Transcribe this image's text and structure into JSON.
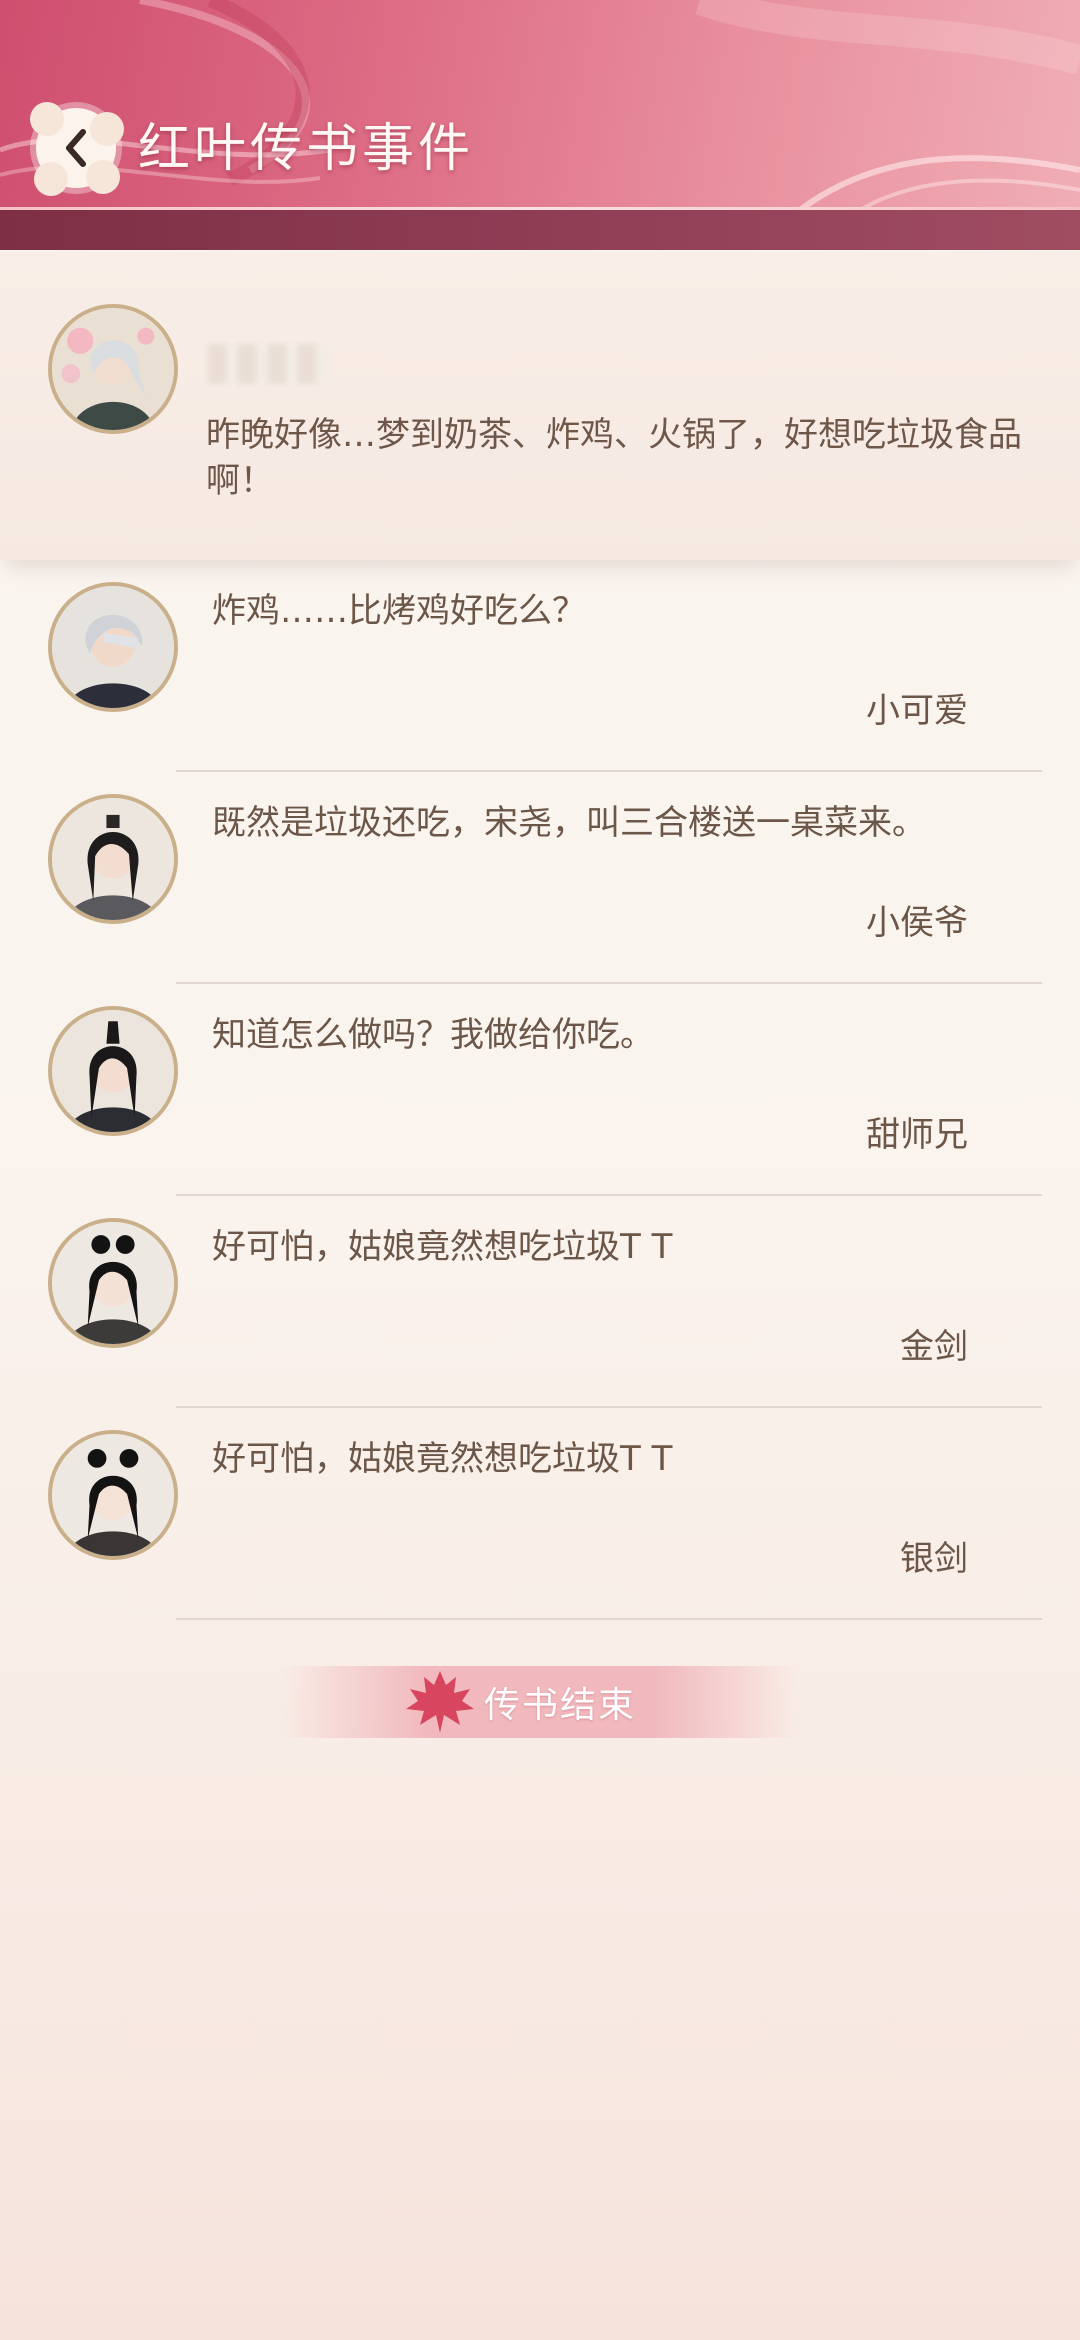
{
  "header": {
    "title": "红叶传书事件",
    "back_icon": "chevron-left-icon",
    "colors": {
      "primary": "#d4577a",
      "band": "#8a3a50"
    }
  },
  "post": {
    "text": "昨晚好像…梦到奶茶、炸鸡、火锅了，好想吃垃圾食品啊！"
  },
  "replies": [
    {
      "text": "炸鸡……比烤鸡好吃么？",
      "author": "小可爱"
    },
    {
      "text": "既然是垃圾还吃，宋尧，叫三合楼送一桌菜来。",
      "author": "小侯爷"
    },
    {
      "text": "知道怎么做吗？我做给你吃。",
      "author": "甜师兄"
    },
    {
      "text": "好可怕，姑娘竟然想吃垃圾T T",
      "author": "金剑"
    },
    {
      "text": "好可怕，姑娘竟然想吃垃圾T T",
      "author": "银剑"
    }
  ],
  "end_banner": {
    "text": "传书结束",
    "icon": "maple-leaf-icon"
  }
}
